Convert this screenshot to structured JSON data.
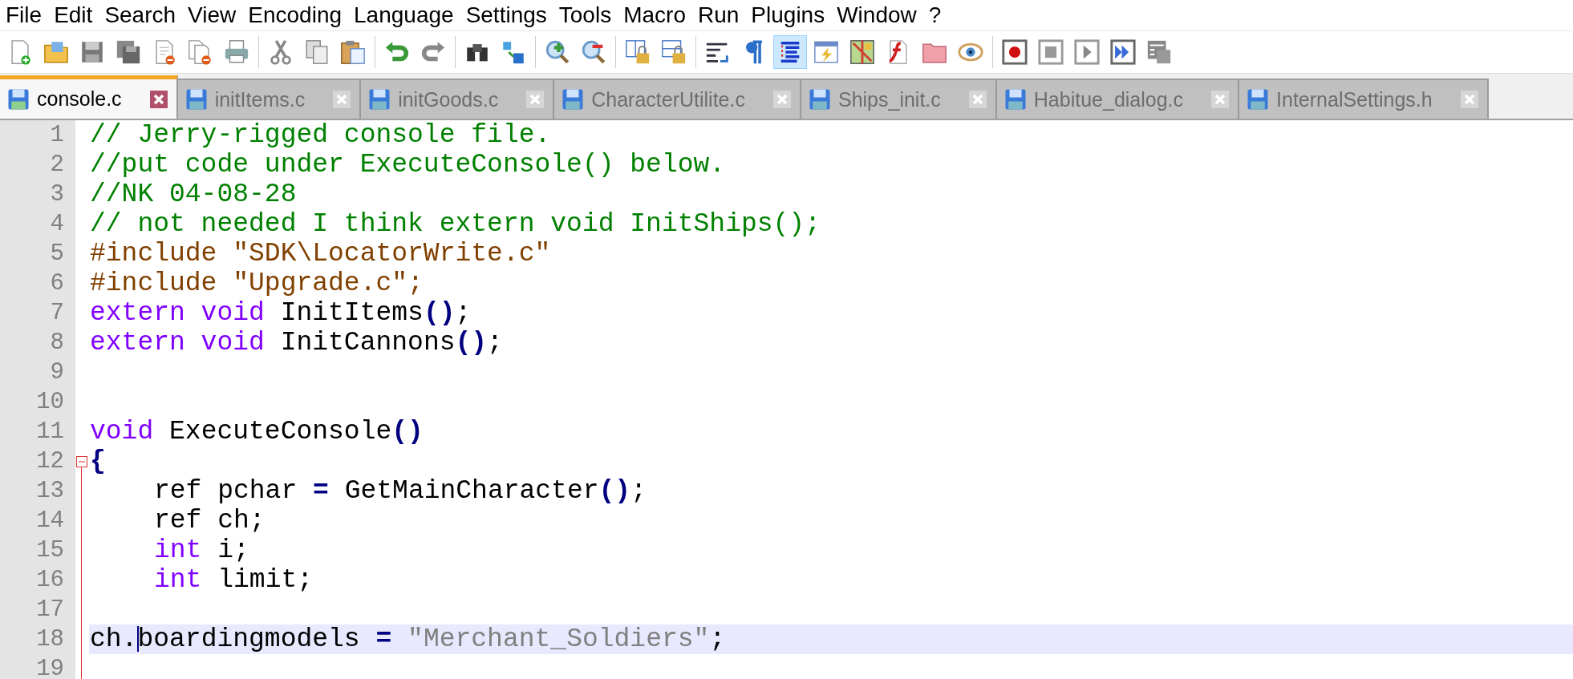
{
  "menu": [
    "File",
    "Edit",
    "Search",
    "View",
    "Encoding",
    "Language",
    "Settings",
    "Tools",
    "Macro",
    "Run",
    "Plugins",
    "Window",
    "?"
  ],
  "toolbar": [
    {
      "kind": "new",
      "pressed": false
    },
    {
      "kind": "open",
      "pressed": false
    },
    {
      "kind": "save",
      "pressed": false
    },
    {
      "kind": "saveall",
      "pressed": false
    },
    {
      "kind": "close",
      "pressed": false
    },
    {
      "kind": "closeall",
      "pressed": false
    },
    {
      "kind": "print",
      "pressed": false
    },
    {
      "kind": "separator"
    },
    {
      "kind": "cut",
      "pressed": false
    },
    {
      "kind": "copy",
      "pressed": false
    },
    {
      "kind": "paste",
      "pressed": false
    },
    {
      "kind": "separator"
    },
    {
      "kind": "undo",
      "pressed": false
    },
    {
      "kind": "redo",
      "pressed": false
    },
    {
      "kind": "separator"
    },
    {
      "kind": "find",
      "pressed": false
    },
    {
      "kind": "replace",
      "pressed": false
    },
    {
      "kind": "separator"
    },
    {
      "kind": "zoomin",
      "pressed": false
    },
    {
      "kind": "zoomout",
      "pressed": false
    },
    {
      "kind": "separator"
    },
    {
      "kind": "syncv",
      "pressed": false
    },
    {
      "kind": "synch",
      "pressed": false
    },
    {
      "kind": "separator"
    },
    {
      "kind": "wrap",
      "pressed": false
    },
    {
      "kind": "allchars",
      "pressed": false
    },
    {
      "kind": "indentguide",
      "pressed": true
    },
    {
      "kind": "udl",
      "pressed": false
    },
    {
      "kind": "docmap",
      "pressed": false
    },
    {
      "kind": "funclist",
      "pressed": false
    },
    {
      "kind": "folder",
      "pressed": false
    },
    {
      "kind": "monitor",
      "pressed": false
    },
    {
      "kind": "separator"
    },
    {
      "kind": "record",
      "pressed": false
    },
    {
      "kind": "stop",
      "pressed": false
    },
    {
      "kind": "play",
      "pressed": false
    },
    {
      "kind": "playmulti",
      "pressed": false
    },
    {
      "kind": "savemacro",
      "pressed": false
    }
  ],
  "tabs": [
    {
      "label": "console.c",
      "selected": true
    },
    {
      "label": "initItems.c",
      "selected": false
    },
    {
      "label": "initGoods.c",
      "selected": false
    },
    {
      "label": "CharacterUtilite.c",
      "selected": false
    },
    {
      "label": "Ships_init.c",
      "selected": false
    },
    {
      "label": "Habitue_dialog.c",
      "selected": false
    },
    {
      "label": "InternalSettings.h",
      "selected": false
    }
  ],
  "lines": [
    {
      "number": "1",
      "current": false,
      "tokens": [
        {
          "kind": "comment",
          "text": "// Jerry-rigged console file."
        }
      ]
    },
    {
      "number": "2",
      "current": false,
      "tokens": [
        {
          "kind": "comment",
          "text": "//put code under ExecuteConsole() below."
        }
      ]
    },
    {
      "number": "3",
      "current": false,
      "tokens": [
        {
          "kind": "comment",
          "text": "//NK 04-08-28"
        }
      ]
    },
    {
      "number": "4",
      "current": false,
      "tokens": [
        {
          "kind": "comment",
          "text": "// not needed I think extern void InitShips();"
        }
      ]
    },
    {
      "number": "5",
      "current": false,
      "tokens": [
        {
          "kind": "preproc",
          "text": "#include \"SDK\\LocatorWrite.c\""
        }
      ]
    },
    {
      "number": "6",
      "current": false,
      "tokens": [
        {
          "kind": "preproc",
          "text": "#include \"Upgrade.c\";"
        }
      ]
    },
    {
      "number": "7",
      "current": false,
      "tokens": [
        {
          "kind": "keyword",
          "text": "extern void"
        },
        {
          "kind": "plain",
          "text": " InitItems"
        },
        {
          "kind": "operator",
          "text": "()"
        },
        {
          "kind": "plain",
          "text": ";"
        }
      ]
    },
    {
      "number": "8",
      "current": false,
      "tokens": [
        {
          "kind": "keyword",
          "text": "extern void"
        },
        {
          "kind": "plain",
          "text": " InitCannons"
        },
        {
          "kind": "operator",
          "text": "()"
        },
        {
          "kind": "plain",
          "text": ";"
        }
      ]
    },
    {
      "number": "9"
    },
    {
      "number": "10"
    },
    {
      "number": "11",
      "current": false,
      "tokens": [
        {
          "kind": "keyword",
          "text": "void"
        },
        {
          "kind": "plain",
          "text": " ExecuteConsole"
        },
        {
          "kind": "operator",
          "text": "()"
        }
      ]
    },
    {
      "number": "12",
      "current": false,
      "expanded": true,
      "tokens": [
        {
          "kind": "operator",
          "text": "{"
        }
      ]
    },
    {
      "number": "13",
      "current": false,
      "fold_body": true,
      "indented": true,
      "tokens": [
        {
          "kind": "plain",
          "text": "ref pchar "
        },
        {
          "kind": "operator",
          "text": "="
        },
        {
          "kind": "plain",
          "text": " GetMainCharacter"
        },
        {
          "kind": "operator",
          "text": "()"
        },
        {
          "kind": "plain",
          "text": ";"
        }
      ]
    },
    {
      "number": "14",
      "current": false,
      "fold_body": true,
      "indented": true,
      "tokens": [
        {
          "kind": "plain",
          "text": "ref ch;"
        }
      ]
    },
    {
      "number": "15",
      "current": false,
      "fold_body": true,
      "indented": true,
      "tokens": [
        {
          "kind": "keyword",
          "text": "int"
        },
        {
          "kind": "plain",
          "text": " i;"
        }
      ]
    },
    {
      "number": "16",
      "current": false,
      "fold_body": true,
      "indented": true,
      "tokens": [
        {
          "kind": "keyword",
          "text": "int"
        },
        {
          "kind": "plain",
          "text": " limit;"
        }
      ]
    },
    {
      "number": "17",
      "fold_body": true
    },
    {
      "number": "18",
      "current": true,
      "fold_body": true,
      "tokens": [
        {
          "kind": "plain",
          "text": "ch."
        },
        {
          "kind": "plain",
          "text": "boardingmodels ",
          "caret_before": true
        },
        {
          "kind": "operator",
          "text": "="
        },
        {
          "kind": "string",
          "text": " \"Merchant_Soldiers\""
        },
        {
          "kind": "plain",
          "text": ";"
        }
      ]
    },
    {
      "number": "19",
      "fold_body": true
    }
  ]
}
